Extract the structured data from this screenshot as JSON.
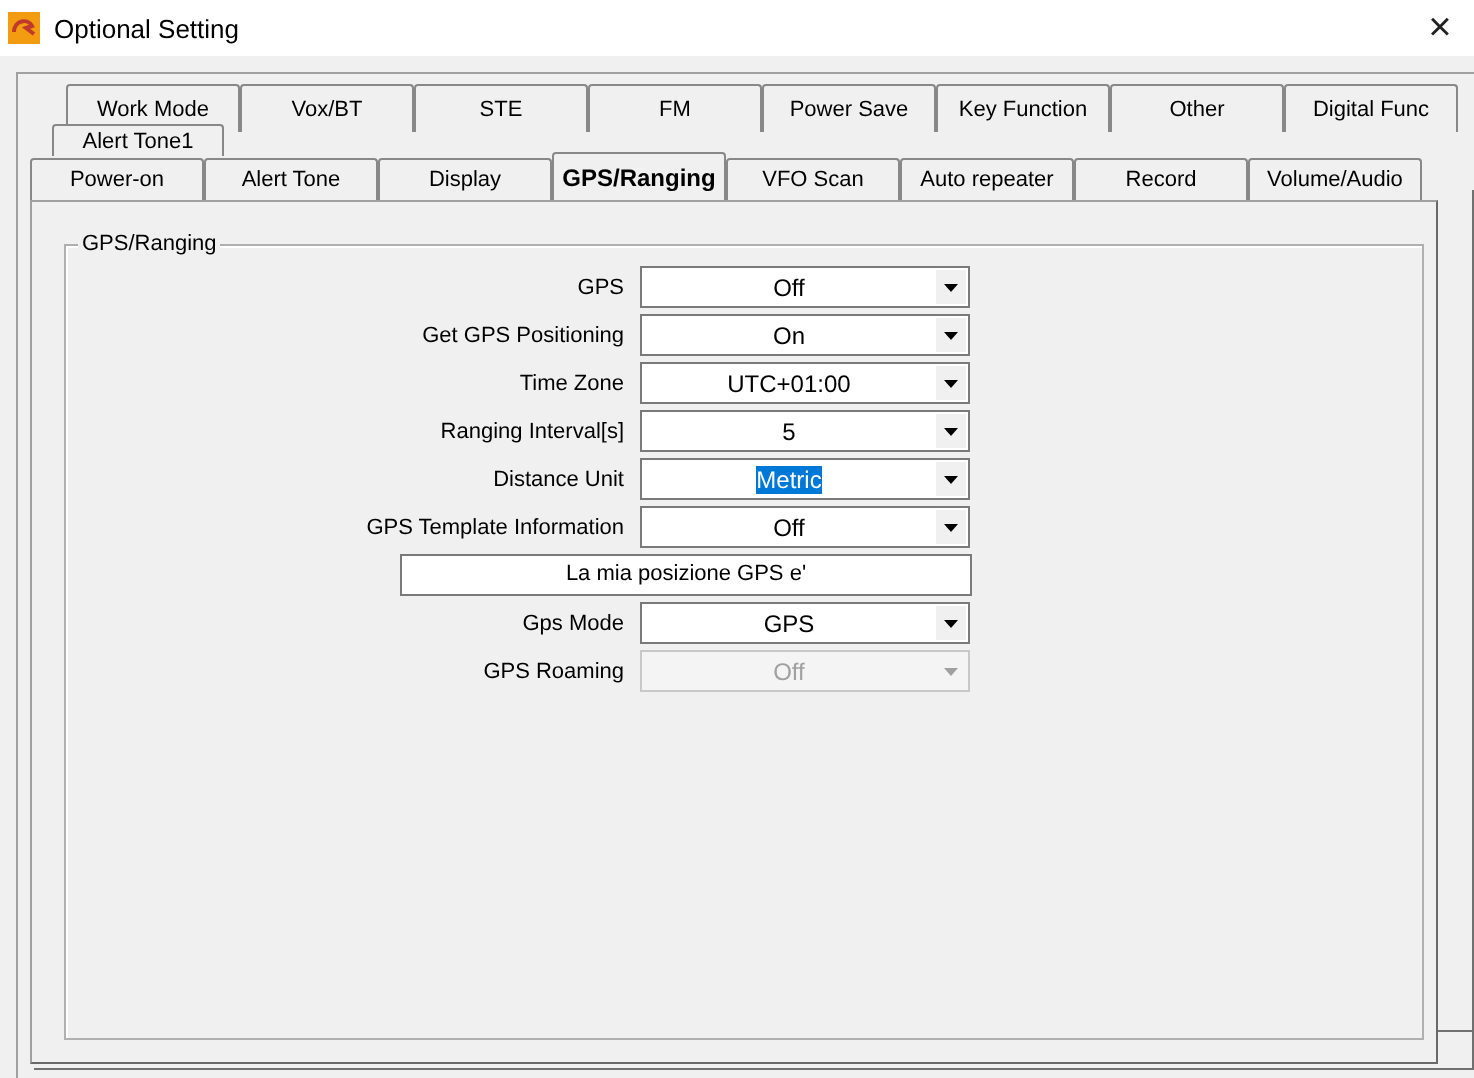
{
  "window": {
    "title": "Optional Setting",
    "close": "×"
  },
  "tab_rows": [
    {
      "tabs": [
        {
          "label": "Work Mode",
          "selected": false
        },
        {
          "label": "Vox/BT",
          "selected": false
        },
        {
          "label": "STE",
          "selected": false
        },
        {
          "label": "FM",
          "selected": false
        },
        {
          "label": "Power Save",
          "selected": false
        },
        {
          "label": "Key Function",
          "selected": false
        },
        {
          "label": "Other",
          "selected": false
        },
        {
          "label": "Digital Func",
          "selected": false
        }
      ]
    },
    {
      "tabs": [
        {
          "label": "Alert Tone1",
          "selected": false
        }
      ]
    },
    {
      "tabs": [
        {
          "label": "Power-on",
          "selected": false
        },
        {
          "label": "Alert Tone",
          "selected": false
        },
        {
          "label": "Display",
          "selected": false
        },
        {
          "label": "GPS/Ranging",
          "selected": true
        },
        {
          "label": "VFO Scan",
          "selected": false
        },
        {
          "label": "Auto repeater",
          "selected": false
        },
        {
          "label": "Record",
          "selected": false
        },
        {
          "label": "Volume/Audio",
          "selected": false
        }
      ]
    }
  ],
  "group": {
    "title": "GPS/Ranging",
    "fields": [
      {
        "kind": "combo",
        "label": "GPS",
        "value": "Off",
        "highlighted": false,
        "disabled": false
      },
      {
        "kind": "combo",
        "label": "Get GPS Positioning",
        "value": "On",
        "highlighted": false,
        "disabled": false
      },
      {
        "kind": "combo",
        "label": "Time Zone",
        "value": "UTC+01:00",
        "highlighted": false,
        "disabled": false
      },
      {
        "kind": "combo",
        "label": "Ranging Interval[s]",
        "value": "5",
        "highlighted": false,
        "disabled": false
      },
      {
        "kind": "combo",
        "label": "Distance Unit",
        "value": "Metric",
        "highlighted": true,
        "disabled": false
      },
      {
        "kind": "combo",
        "label": "GPS Template Information",
        "value": "Off",
        "highlighted": false,
        "disabled": false
      },
      {
        "kind": "text",
        "value": "La mia posizione GPS e'"
      },
      {
        "kind": "combo",
        "label": "Gps Mode",
        "value": "GPS",
        "highlighted": false,
        "disabled": false
      },
      {
        "kind": "combo",
        "label": "GPS Roaming",
        "value": "Off",
        "highlighted": false,
        "disabled": true
      }
    ]
  }
}
